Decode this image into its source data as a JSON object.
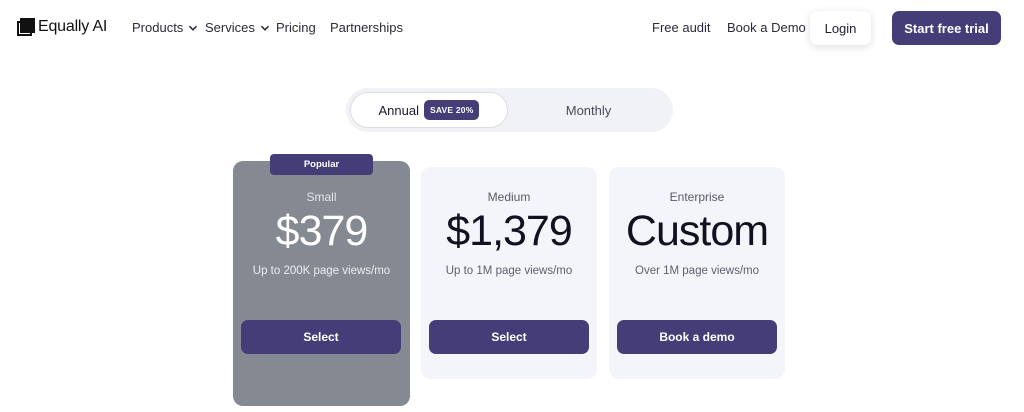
{
  "nav": {
    "logo_text": "Equally AI",
    "links": {
      "products": "Products",
      "services": "Services",
      "pricing": "Pricing",
      "partnerships": "Partnerships",
      "free_audit": "Free audit",
      "book_demo": "Book a Demo"
    },
    "login_label": "Login",
    "trial_label": "Start free trial"
  },
  "billing_toggle": {
    "annual_label": "Annual",
    "save_badge": "SAVE 20%",
    "monthly_label": "Monthly",
    "selected": "Annual"
  },
  "plans": [
    {
      "badge": "Popular",
      "name": "Small",
      "price": "$379",
      "subtitle": "Up to 200K page views/mo",
      "button": "Select"
    },
    {
      "name": "Medium",
      "price": "$1,379",
      "subtitle": "Up to 1M page views/mo",
      "button": "Select"
    },
    {
      "name": "Enterprise",
      "price": "Custom",
      "subtitle": "Over 1M page views/mo",
      "button": "Book a demo"
    }
  ],
  "colors": {
    "accent": "#443d78",
    "highlight_card": "#858991",
    "card_bg": "#f4f5fa",
    "toggle_bg": "#f1f2f6"
  }
}
